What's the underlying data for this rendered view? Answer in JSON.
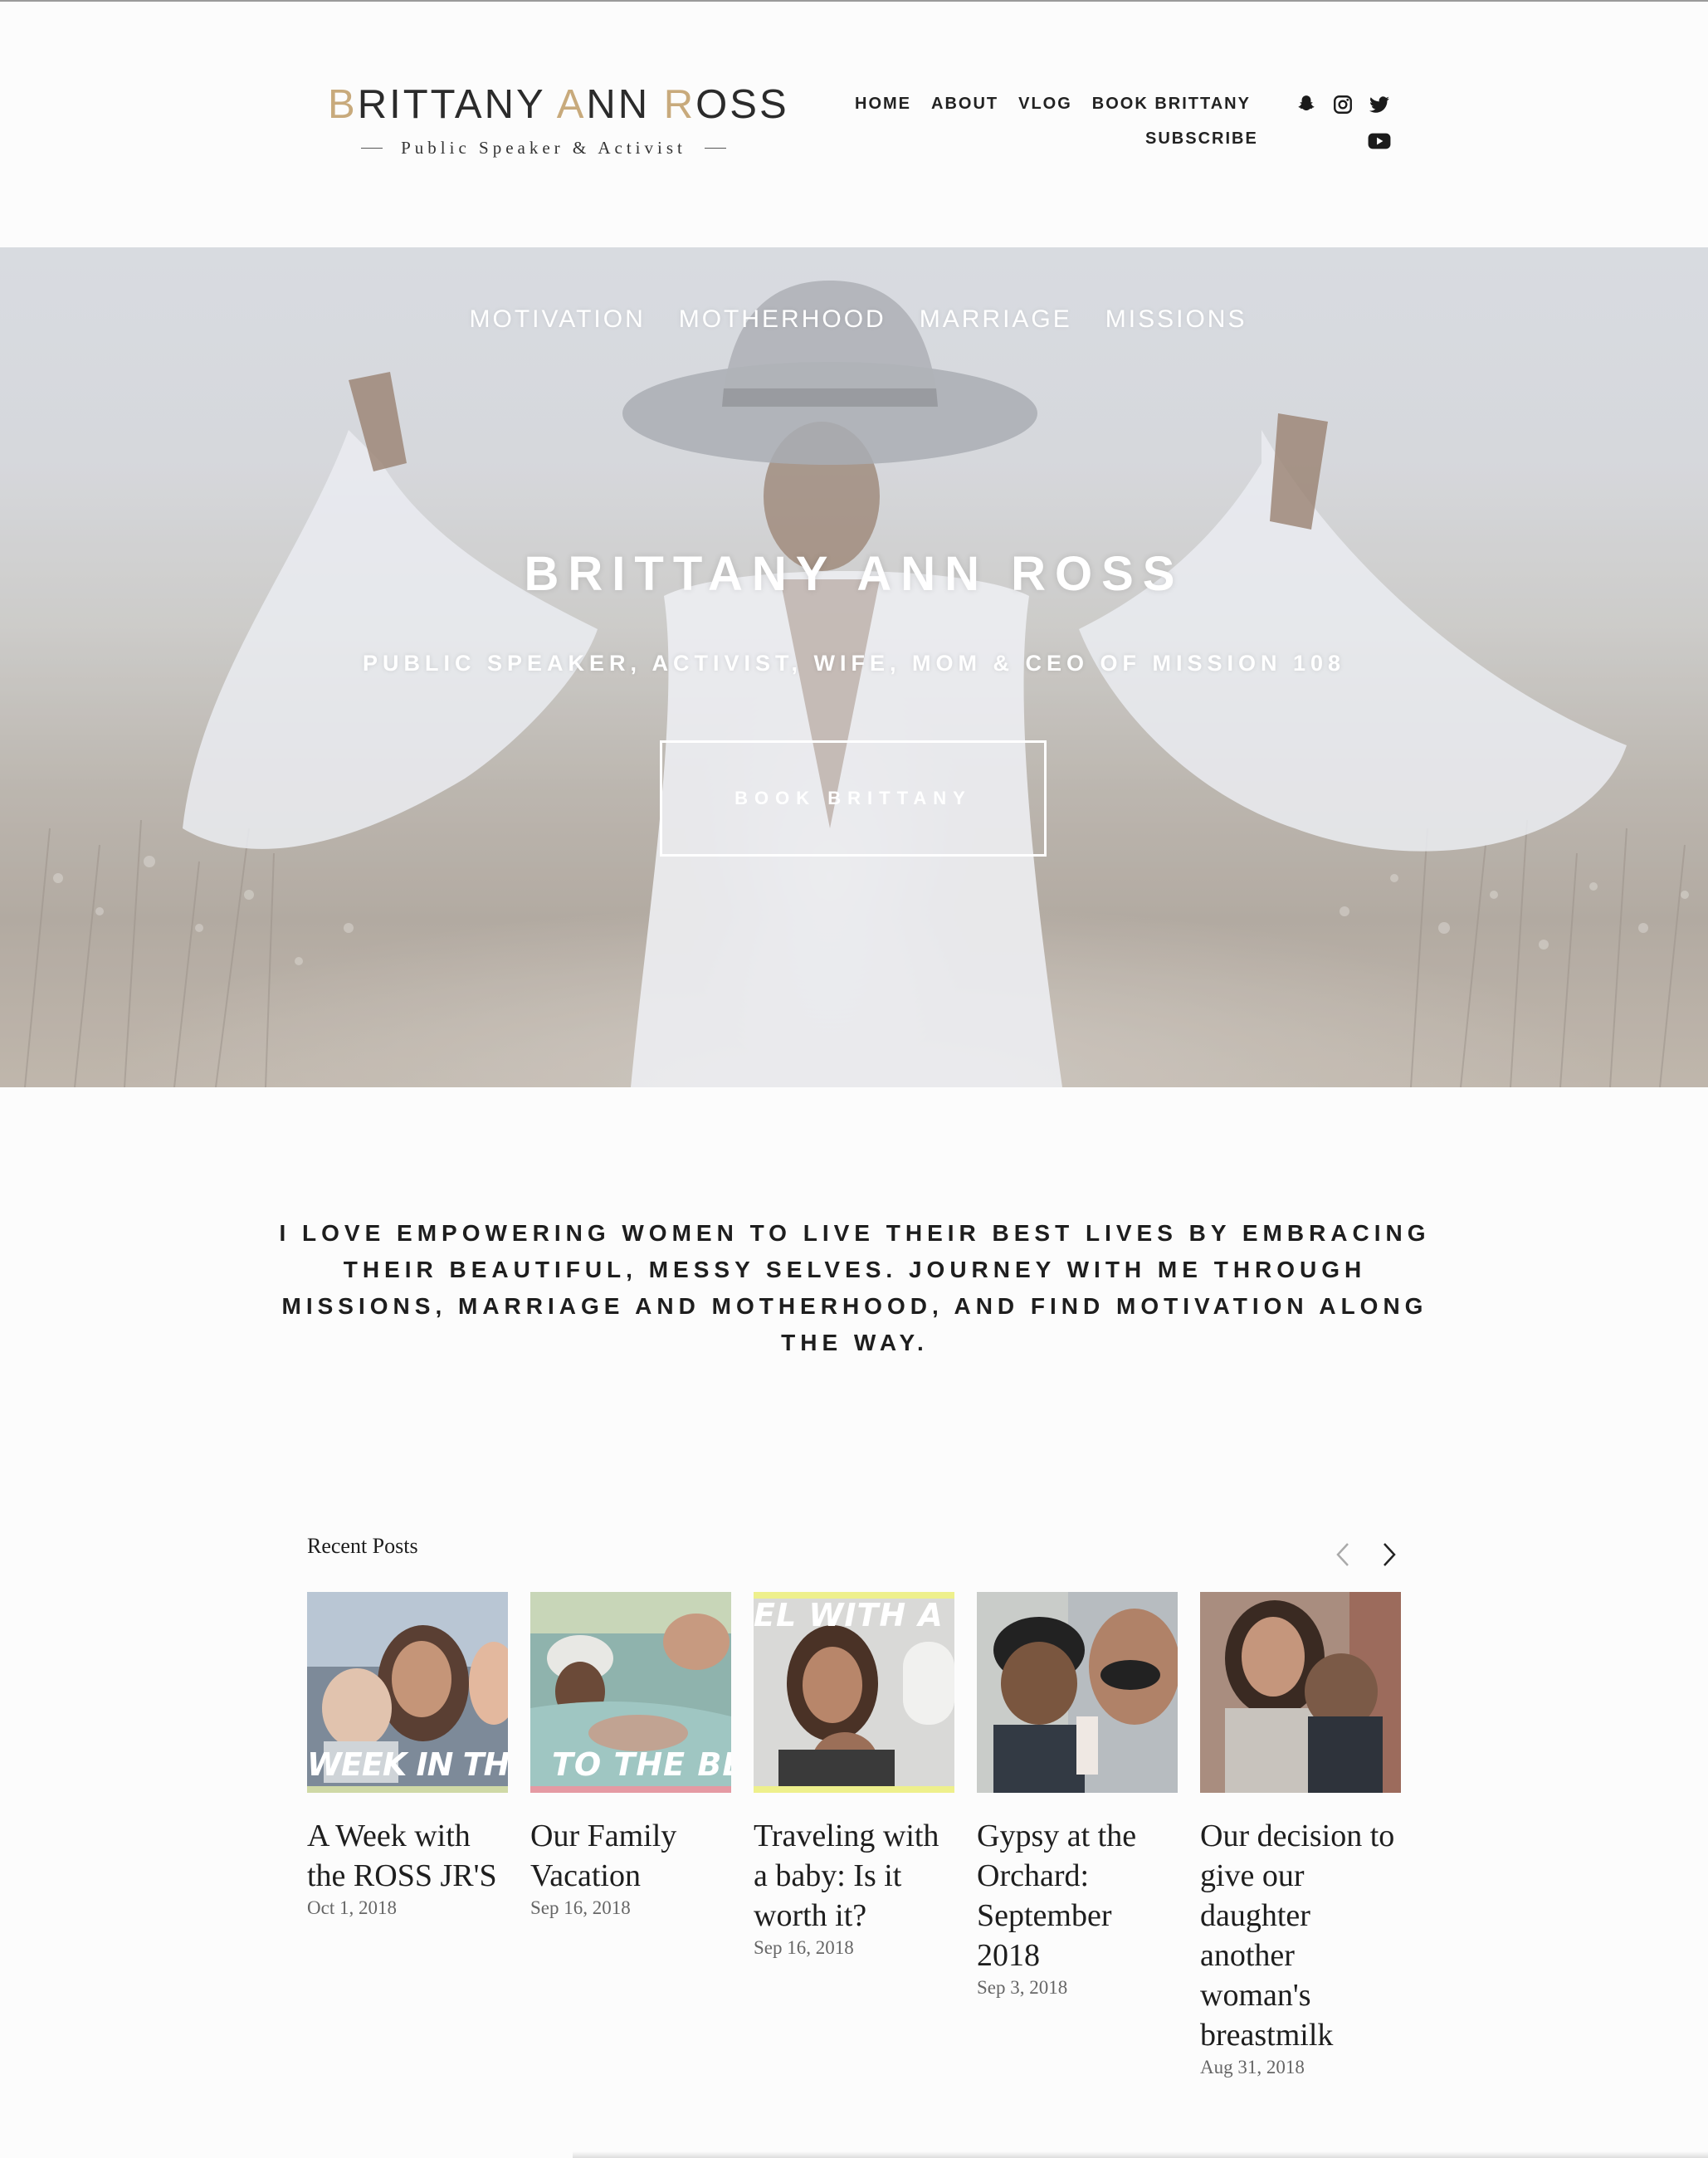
{
  "header": {
    "logo": {
      "name_parts": [
        "B",
        "RITTANY ",
        "A",
        "NN ",
        "R",
        "OSS"
      ],
      "tagline": "Public Speaker & Activist"
    },
    "nav": [
      {
        "label": "HOME"
      },
      {
        "label": "ABOUT"
      },
      {
        "label": "VLOG"
      },
      {
        "label": "BOOK BRITTANY"
      },
      {
        "label": "SUBSCRIBE"
      }
    ],
    "social_icons": [
      "snapchat-icon",
      "instagram-icon",
      "twitter-icon",
      "youtube-icon"
    ]
  },
  "hero": {
    "categories": [
      "MOTIVATION",
      "MOTHERHOOD",
      "MARRIAGE",
      "MISSIONS"
    ],
    "title": "BRITTANY ANN ROSS",
    "subtitle": "PUBLIC SPEAKER, ACTIVIST, WIFE, MOM & CEO OF MISSION 108",
    "button": "BOOK BRITTANY"
  },
  "intro": {
    "text": "I LOVE EMPOWERING WOMEN TO LIVE THEIR BEST LIVES BY EMBRACING THEIR BEAUTIFUL, MESSY SELVES. JOURNEY WITH ME THROUGH MISSIONS, MARRIAGE AND MOTHERHOOD, AND FIND MOTIVATION ALONG THE WAY."
  },
  "recent_posts": {
    "heading": "Recent Posts",
    "posts": [
      {
        "title": "A Week with the ROSS JR'S",
        "date": "Oct 1, 2018",
        "thumb_caption": "WEEK IN THE",
        "accent": "#cfd9a6"
      },
      {
        "title": "Our Family Vacation",
        "date": "Sep 16, 2018",
        "thumb_caption": "TO THE BE",
        "accent": "#e59aa3"
      },
      {
        "title": "Traveling with a baby: Is it worth it?",
        "date": "Sep 16, 2018",
        "thumb_caption": "EL WITH A B",
        "accent": "#eef08c"
      },
      {
        "title": "Gypsy at the Orchard: September 2018",
        "date": "Sep 3, 2018",
        "thumb_caption": "",
        "accent": ""
      },
      {
        "title": "Our decision to give our daughter another woman's breastmilk",
        "date": "Aug 31, 2018",
        "thumb_caption": "",
        "accent": ""
      }
    ]
  }
}
